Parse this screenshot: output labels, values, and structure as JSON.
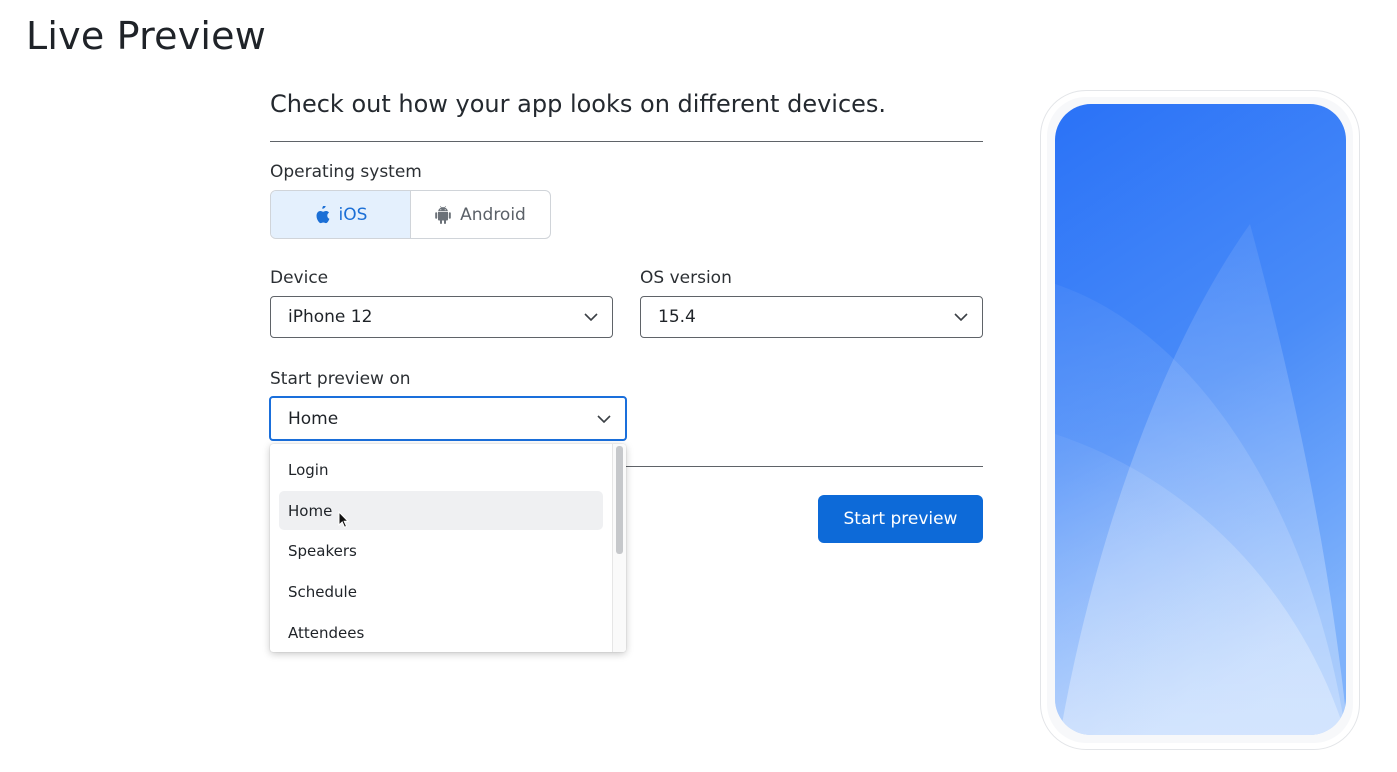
{
  "page": {
    "title": "Live Preview"
  },
  "intro": {
    "text": "Check out how your app looks on different devices."
  },
  "os_selector": {
    "label": "Operating system",
    "options": [
      {
        "label": "iOS",
        "icon": "apple-icon",
        "selected": true
      },
      {
        "label": "Android",
        "icon": "android-icon",
        "selected": false
      }
    ]
  },
  "device": {
    "label": "Device",
    "value": "iPhone 12"
  },
  "os_version": {
    "label": "OS version",
    "value": "15.4"
  },
  "start_on": {
    "label": "Start preview on",
    "value": "Home",
    "options": [
      "Login",
      "Home",
      "Speakers",
      "Schedule",
      "Attendees"
    ],
    "hovered_index": 1
  },
  "actions": {
    "start_label": "Start preview"
  },
  "colors": {
    "accent": "#0d6ad8",
    "selected_segment_bg": "#e4f0fd",
    "phone_screen_top": "#2a72f7",
    "phone_screen_bottom": "#a6cbfe"
  }
}
